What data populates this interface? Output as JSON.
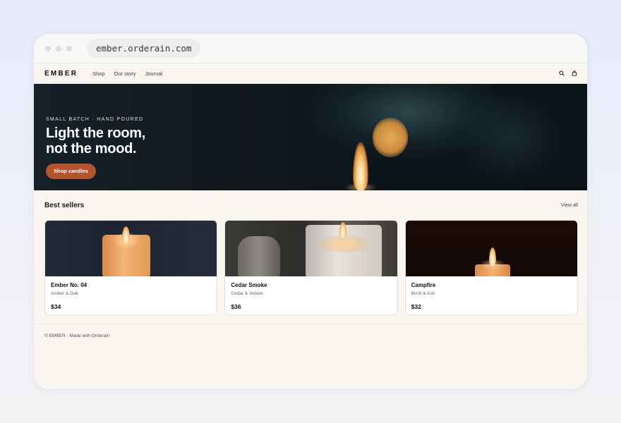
{
  "browser": {
    "url": "ember.orderain.com"
  },
  "nav": {
    "logo": "EMBER",
    "links": [
      "Shop",
      "Our story",
      "Journal"
    ]
  },
  "hero": {
    "eyebrow": "SMALL BATCH · HAND POURED",
    "headline_line1": "Light the room,",
    "headline_line2": "not the mood.",
    "cta": "Shop candles"
  },
  "section": {
    "title": "Best sellers",
    "view_all": "View all"
  },
  "products": [
    {
      "name": "Ember No. 04",
      "scent": "Amber & Oak",
      "price": "$34"
    },
    {
      "name": "Cedar Smoke",
      "scent": "Cedar & Vetiver",
      "price": "$36"
    },
    {
      "name": "Campfire",
      "scent": "Birch & Ash",
      "price": "$32"
    }
  ],
  "footer": {
    "text": "© EMBER · Made with Orderain"
  },
  "colors": {
    "accent": "#b5532d",
    "page_bg": "#f9f6ef",
    "hero_bg": "#12191f"
  },
  "icons": [
    "search-icon",
    "bag-icon"
  ]
}
